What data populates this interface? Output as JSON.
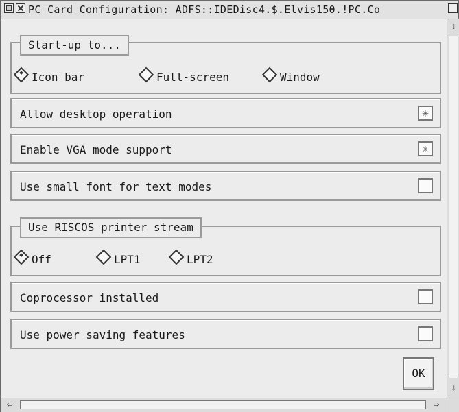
{
  "window": {
    "title": "PC Card Configuration: ADFS::IDEDisc4.$.Elvis150.!PC.Co"
  },
  "startup": {
    "group_label": "Start-up to...",
    "options": [
      {
        "label": "Icon bar",
        "selected": true
      },
      {
        "label": "Full-screen",
        "selected": false
      },
      {
        "label": "Window",
        "selected": false
      }
    ]
  },
  "settings": {
    "desktop": {
      "label": "Allow desktop operation",
      "checked": true
    },
    "vga": {
      "label": "Enable VGA mode support",
      "checked": true
    },
    "small_font": {
      "label": "Use small font for text modes",
      "checked": false
    },
    "coprocessor": {
      "label": "Coprocessor installed",
      "checked": false
    },
    "power_saving": {
      "label": "Use power saving features",
      "checked": false
    }
  },
  "printer": {
    "group_label": "Use RISCOS printer stream",
    "options": [
      {
        "label": "Off",
        "selected": true
      },
      {
        "label": "LPT1",
        "selected": false
      },
      {
        "label": "LPT2",
        "selected": false
      }
    ]
  },
  "buttons": {
    "ok_label": "OK"
  },
  "icons": {
    "back": "back-icon",
    "close": "close-icon",
    "toggle_size": "toggle-size-icon",
    "checked_mark": "✳"
  }
}
